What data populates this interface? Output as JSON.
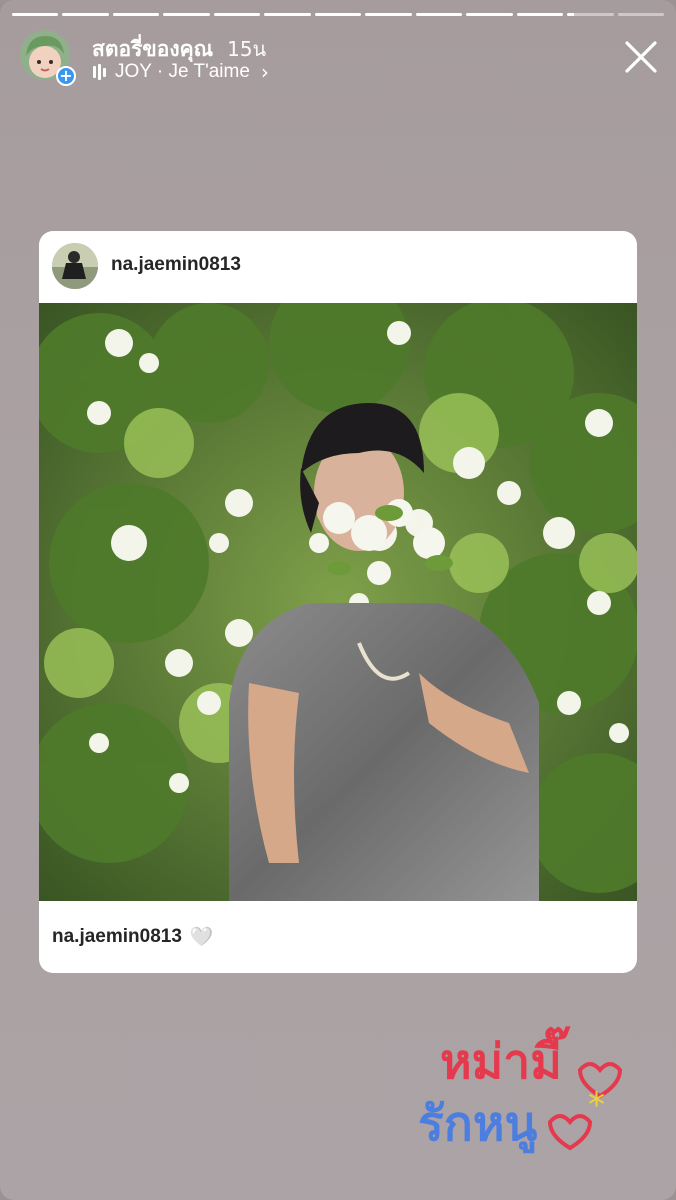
{
  "story": {
    "title": "สตอรี่ของคุณ",
    "time": "15น",
    "music": {
      "artist_track": "JOY · Je T'aime",
      "chevron": "›"
    },
    "progress": [
      1,
      1,
      1,
      1,
      1,
      1,
      1,
      1,
      1,
      1,
      1,
      0.15,
      0
    ]
  },
  "card": {
    "username": "na.jaemin0813",
    "caption_username": "na.jaemin0813",
    "caption_emoji": "🤍"
  },
  "sticker": {
    "line1": "หม่ามี๊",
    "line2": "รักหนู"
  },
  "icons": {
    "close": "close-icon",
    "add": "add-story-icon",
    "music": "music-bars-icon"
  },
  "colors": {
    "accent": "#3897f0",
    "background": "#aaa1a3"
  }
}
